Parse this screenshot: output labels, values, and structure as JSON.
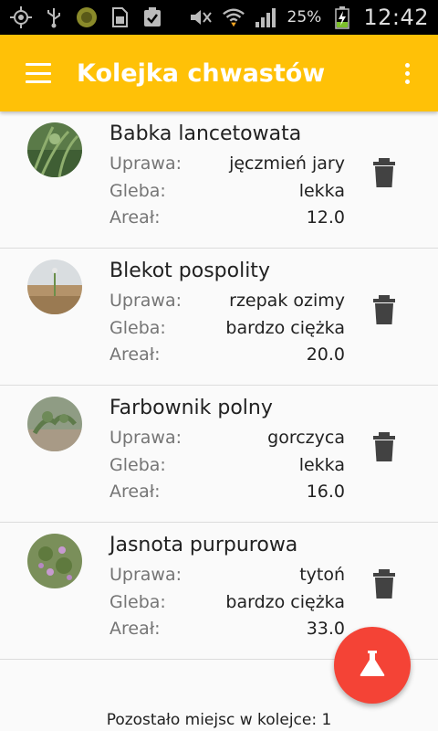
{
  "status_bar": {
    "battery_percent": "25%",
    "time": "12:42"
  },
  "app_bar": {
    "title": "Kolejka chwastów",
    "color": "#FFC107"
  },
  "labels": {
    "crop": "Uprawa:",
    "soil": "Gleba:",
    "area": "Areał:"
  },
  "items": [
    {
      "name": "Babka lancetowata",
      "crop": "jęczmień jary",
      "soil": "lekka",
      "area": "12.0"
    },
    {
      "name": "Blekot pospolity",
      "crop": "rzepak ozimy",
      "soil": "bardzo ciężka",
      "area": "20.0"
    },
    {
      "name": "Farbownik polny",
      "crop": "gorczyca",
      "soil": "lekka",
      "area": "16.0"
    },
    {
      "name": "Jasnota purpurowa",
      "crop": "tytoń",
      "soil": "bardzo ciężka",
      "area": "33.0"
    }
  ],
  "fab": {
    "icon": "flask-icon",
    "color": "#F44336"
  },
  "footer": {
    "text": "Pozostało miejsc w kolejce: 1"
  }
}
